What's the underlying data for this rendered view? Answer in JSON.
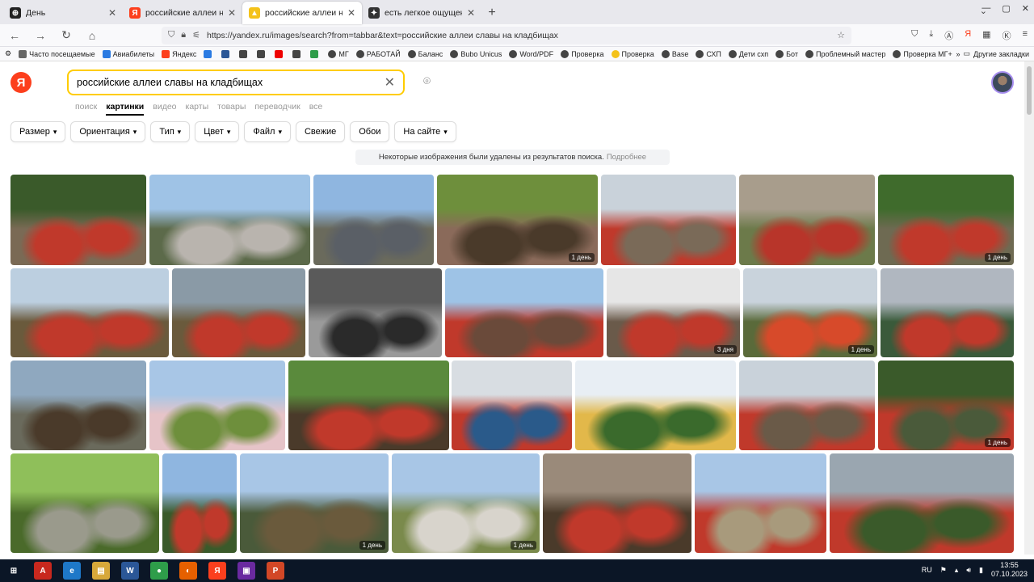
{
  "browser": {
    "tabs": [
      {
        "title": "День",
        "icon": "plus-circle-icon",
        "icon_color": "#222222",
        "active": false
      },
      {
        "title": "российские аллеи на кл",
        "icon": "yandex-icon",
        "icon_color": "#fc3f1d",
        "active": false
      },
      {
        "title": "российские аллеи на кл",
        "icon": "images-icon",
        "icon_color": "#f4c21a",
        "active": true
      },
      {
        "title": "есть легкое ощущение, что За",
        "icon": "chat-icon",
        "icon_color": "#333333",
        "active": false
      }
    ],
    "url": "https://yandex.ru/images/search?from=tabbar&text=российские аллеи славы на кладбищах",
    "bookmarks": [
      "Часто посещаемые",
      "Авиабилеты",
      "Яндекс",
      "",
      "",
      "",
      "",
      "",
      "",
      "",
      "МГ",
      "РАБОТАЙ",
      "Баланс",
      "Bubo Unicus",
      "Word/PDF",
      "Проверка",
      "Проверка",
      "Base",
      "СХП",
      "Дети схп",
      "Бот",
      "Проблемный мастер",
      "Проверка МГ+"
    ],
    "other_bookmarks": "Другие закладки"
  },
  "yandex": {
    "logo": "Я",
    "query": "российские аллеи славы на кладбищах",
    "services": [
      "поиск",
      "картинки",
      "видео",
      "карты",
      "товары",
      "переводчик",
      "все"
    ],
    "active_service": "картинки",
    "filters": [
      {
        "label": "Размер",
        "dropdown": true
      },
      {
        "label": "Ориентация",
        "dropdown": true
      },
      {
        "label": "Тип",
        "dropdown": true
      },
      {
        "label": "Цвет",
        "dropdown": true
      },
      {
        "label": "Файл",
        "dropdown": true
      },
      {
        "label": "Свежие",
        "dropdown": false
      },
      {
        "label": "Обои",
        "dropdown": false
      },
      {
        "label": "На сайте",
        "dropdown": true
      }
    ],
    "notice": "Некоторые изображения были удалены из результатов поиска.",
    "notice_link": "Подробнее",
    "rows": [
      [
        {
          "colors": [
            "#3a5a2a",
            "#c0392b",
            "#7a6a55"
          ],
          "badge": ""
        },
        {
          "colors": [
            "#9fc3e6",
            "#b9b4ae",
            "#5c6a4a"
          ],
          "badge": ""
        },
        {
          "colors": [
            "#8fb6e0",
            "#5a5f66",
            "#6a6a5c"
          ],
          "badge": ""
        },
        {
          "colors": [
            "#6e8f3c",
            "#4a3a2a",
            "#8a6a5a"
          ],
          "badge": "1 день"
        },
        {
          "colors": [
            "#c9d2da",
            "#7a6a58",
            "#c0392b"
          ],
          "badge": ""
        },
        {
          "colors": [
            "#a89d8c",
            "#b8352a",
            "#6c7a4a"
          ],
          "badge": ""
        },
        {
          "colors": [
            "#3f6b2c",
            "#c0392b",
            "#6e6a52"
          ],
          "badge": "1 день"
        }
      ],
      [
        {
          "colors": [
            "#bccfe0",
            "#c0392b",
            "#6a5a3c"
          ],
          "badge": ""
        },
        {
          "colors": [
            "#8a9aa6",
            "#c0392b",
            "#6a5a3c"
          ],
          "badge": ""
        },
        {
          "colors": [
            "#5a5a5a",
            "#2a2a2a",
            "#9a9a9a"
          ],
          "badge": ""
        },
        {
          "colors": [
            "#9ec3e6",
            "#6a4a3a",
            "#c0392b"
          ],
          "badge": ""
        },
        {
          "colors": [
            "#e6e6e6",
            "#c0392b",
            "#6a5a4a"
          ],
          "badge": "3 дня"
        },
        {
          "colors": [
            "#c9d3dc",
            "#d74a2a",
            "#5a6a3a"
          ],
          "badge": "1 день"
        },
        {
          "colors": [
            "#b0b7c0",
            "#c0392b",
            "#3a5a3a"
          ],
          "badge": ""
        }
      ],
      [
        {
          "colors": [
            "#8fa8bf",
            "#4a3a2a",
            "#6a6a5c"
          ],
          "badge": ""
        },
        {
          "colors": [
            "#a8c6e6",
            "#6e8f3c",
            "#e6c4c8"
          ],
          "badge": ""
        },
        {
          "colors": [
            "#5a8a3c",
            "#c0392b",
            "#4a3a2a"
          ],
          "badge": ""
        },
        {
          "colors": [
            "#d8dde2",
            "#2a5a8a",
            "#c0392b"
          ],
          "badge": ""
        },
        {
          "colors": [
            "#e8eef4",
            "#3a6a2c",
            "#e2b84a"
          ],
          "badge": ""
        },
        {
          "colors": [
            "#c9d2da",
            "#6a5a48",
            "#c0392b"
          ],
          "badge": ""
        },
        {
          "colors": [
            "#3a5a2a",
            "#4a5a3a",
            "#c0392b"
          ],
          "badge": "1 день"
        }
      ],
      [
        {
          "colors": [
            "#8fbf5a",
            "#9a9a8c",
            "#4a6a2a"
          ],
          "badge": ""
        },
        {
          "colors": [
            "#8fb6e0",
            "#c0392b",
            "#3a5a2a"
          ],
          "badge": ""
        },
        {
          "colors": [
            "#a8c6e6",
            "#6a5a3c",
            "#4a5a3a"
          ],
          "badge": "1 день"
        },
        {
          "colors": [
            "#a8c6e6",
            "#d8d4cc",
            "#7a8a4c"
          ],
          "badge": "1 день"
        },
        {
          "colors": [
            "#9a8a7a",
            "#c0392b",
            "#4a3a2a"
          ],
          "badge": ""
        },
        {
          "colors": [
            "#a8c6e6",
            "#a89a7c",
            "#c0392b"
          ],
          "badge": ""
        },
        {
          "colors": [
            "#9aa6b0",
            "#3a5a2a",
            "#c0392b"
          ],
          "badge": ""
        }
      ]
    ]
  },
  "taskbar": {
    "apps": [
      {
        "name": "start-icon",
        "color": "#0b1626",
        "label": "⊞"
      },
      {
        "name": "acrobat-icon",
        "color": "#c8281e",
        "label": "A"
      },
      {
        "name": "ie-icon",
        "color": "#1e78c8",
        "label": "e"
      },
      {
        "name": "explorer-icon",
        "color": "#d7a83a",
        "label": "▤"
      },
      {
        "name": "word-icon",
        "color": "#2b5797",
        "label": "W"
      },
      {
        "name": "chrome-icon",
        "color": "#2e9d4a",
        "label": "●"
      },
      {
        "name": "firefox-icon",
        "color": "#e66000",
        "label": "◐"
      },
      {
        "name": "yandex-browser-icon",
        "color": "#fc3f1d",
        "label": "Я"
      },
      {
        "name": "save-icon",
        "color": "#6a2aa0",
        "label": "▣"
      },
      {
        "name": "presentation-icon",
        "color": "#d24726",
        "label": "P"
      }
    ],
    "lang": "RU",
    "time": "13:55",
    "date": "07.10.2023"
  }
}
